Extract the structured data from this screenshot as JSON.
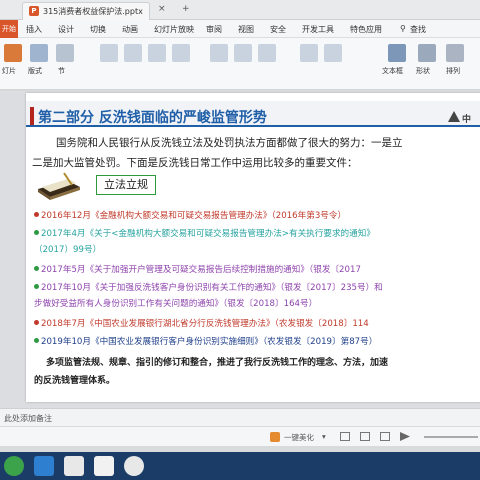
{
  "window": {
    "tab_title": "315消费者权益保护法.pptx",
    "tab_close": "×",
    "tab_new": "+",
    "file_icon": "P"
  },
  "menu": {
    "start": "开始",
    "items": [
      "插入",
      "设计",
      "切换",
      "动画",
      "幻灯片放映",
      "审阅",
      "视图",
      "安全",
      "开发工具",
      "特色应用"
    ],
    "search": "查找"
  },
  "toolbar": {
    "left_labels": [
      "灯片",
      "版式",
      "节"
    ],
    "right_labels": [
      "文本框",
      "形状",
      "排列"
    ],
    "colors": {
      "accent": "#d9562b"
    }
  },
  "slide": {
    "title": "第二部分  反洗钱面临的严峻监管形势",
    "logo_text": "中",
    "intro_line1": "国务院和人民银行从反洗钱立法及处罚执法方面都做了很大的努力：一是立",
    "intro_line2": "二是加大监管处罚。下面是反洗钱日常工作中运用比较多的重要文件：",
    "section_label": "立法立规",
    "documents": [
      {
        "text": "2016年12月《金融机构大额交易和可疑交易报告管理办法》（2016年第3号令）",
        "color": "#c0392b"
      },
      {
        "text": "2017年4月《关于<金融机构大额交易和可疑交易报告管理办法>有关执行要求的通知》",
        "color": "#27a3a0"
      },
      {
        "text": "（2017）99号）",
        "color": "#27a3a0"
      },
      {
        "text": "2017年5月《关于加强开户管理及可疑交易报告后续控制措施的通知》（银发〔2017",
        "color": "#8e44ad"
      },
      {
        "text": "2017年10月《关于加强反洗钱客户身份识别有关工作的通知》（银发〔2017〕235号）和",
        "color": "#8e44ad"
      },
      {
        "text": "步做好受益所有人身份识别工作有关问题的通知》（银发〔2018〕164号）",
        "color": "#8e44ad"
      },
      {
        "text": "2018年7月《中国农业发展银行湖北省分行反洗钱管理办法》（农发银发〔2018〕114",
        "color": "#c0392b"
      },
      {
        "text": "2019年10月《中国农业发展银行客户身份识别实施细则》（农发银发〔2019〕第87号）",
        "color": "#1f3f8a"
      }
    ],
    "summary_line1": "多项监管法规、规章、指引的修订和整合，推进了我行反洗钱工作的理念、方法，加速",
    "summary_line2": "的反洗钱管理体系。"
  },
  "notes": {
    "placeholder": "此处添加备注"
  },
  "status": {
    "beautify": "一键美化",
    "items": [
      "▾"
    ]
  }
}
